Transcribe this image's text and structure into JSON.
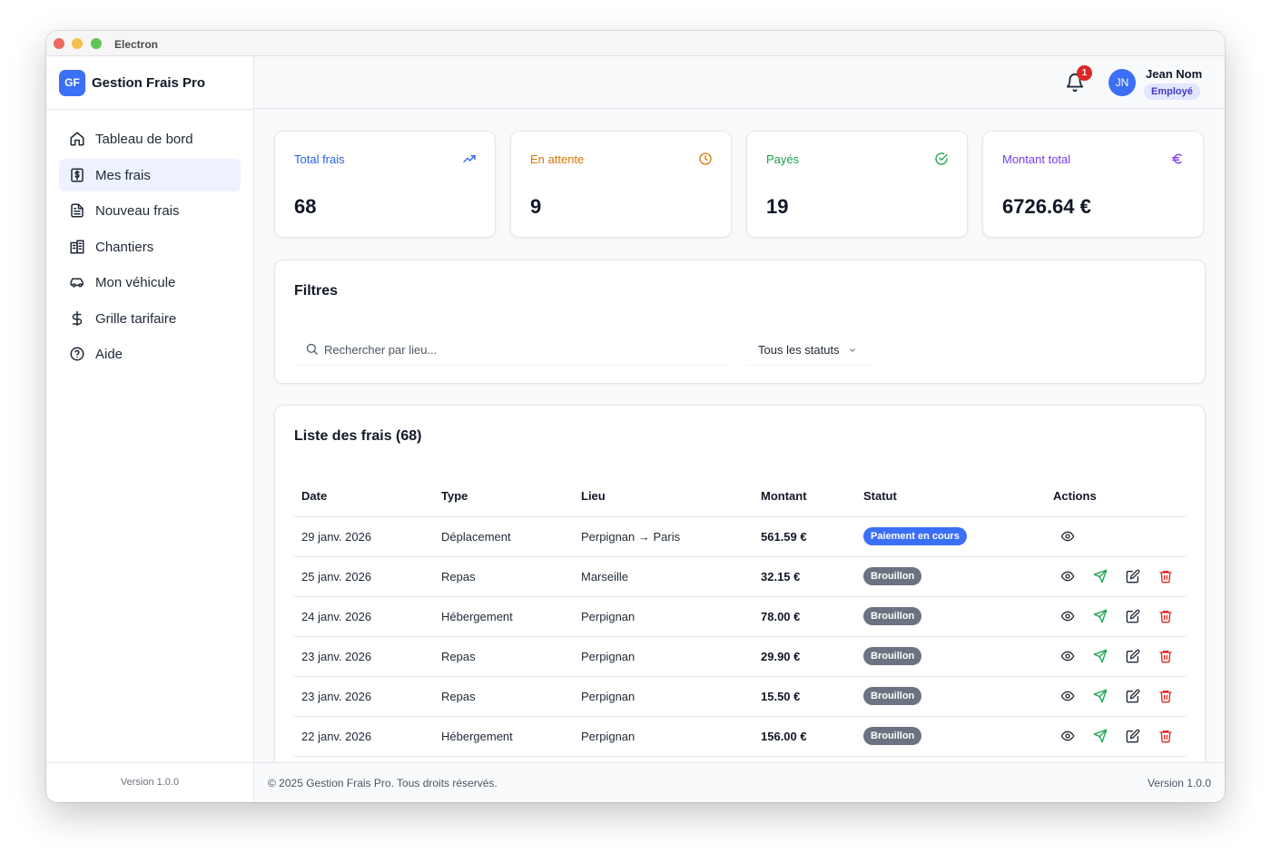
{
  "window": {
    "title": "Electron"
  },
  "brand": {
    "logo": "GF",
    "name": "Gestion Frais Pro"
  },
  "sidebar": {
    "items": [
      {
        "label": "Tableau de bord",
        "icon": "home-icon",
        "active": false
      },
      {
        "label": "Mes frais",
        "icon": "receipt-icon",
        "active": true
      },
      {
        "label": "Nouveau frais",
        "icon": "file-text-icon",
        "active": false
      },
      {
        "label": "Chantiers",
        "icon": "building-icon",
        "active": false
      },
      {
        "label": "Mon véhicule",
        "icon": "car-icon",
        "active": false
      },
      {
        "label": "Grille tarifaire",
        "icon": "dollar-icon",
        "active": false
      },
      {
        "label": "Aide",
        "icon": "help-circle-icon",
        "active": false
      }
    ],
    "version": "Version 1.0.0"
  },
  "header": {
    "notification_count": "1",
    "user": {
      "initials": "JN",
      "name": "Jean Nom",
      "role": "Employé"
    }
  },
  "stats": [
    {
      "label": "Total frais",
      "value": "68",
      "icon": "trending-up-icon",
      "color": "#2563eb"
    },
    {
      "label": "En attente",
      "value": "9",
      "icon": "clock-icon",
      "color": "#d97706"
    },
    {
      "label": "Payés",
      "value": "19",
      "icon": "check-circle-icon",
      "color": "#16a34a"
    },
    {
      "label": "Montant total",
      "value": "6726.64 €",
      "icon": "euro-icon",
      "color": "#7c3aed"
    }
  ],
  "filters": {
    "title": "Filtres",
    "search_placeholder": "Rechercher par lieu...",
    "status_value": "Tous les statuts"
  },
  "list": {
    "title": "Liste des frais (68)",
    "columns": [
      "Date",
      "Type",
      "Lieu",
      "Montant",
      "Statut",
      "Actions"
    ],
    "rows": [
      {
        "date": "29 janv. 2026",
        "type": "Déplacement",
        "lieu": "Perpignan → Paris",
        "montant": "561.59 €",
        "statut": "Paiement en cours",
        "status_color": "blue",
        "actions": [
          "view"
        ]
      },
      {
        "date": "25 janv. 2026",
        "type": "Repas",
        "lieu": "Marseille",
        "montant": "32.15 €",
        "statut": "Brouillon",
        "status_color": "gray",
        "actions": [
          "view",
          "send",
          "edit",
          "delete"
        ]
      },
      {
        "date": "24 janv. 2026",
        "type": "Hébergement",
        "lieu": "Perpignan",
        "montant": "78.00 €",
        "statut": "Brouillon",
        "status_color": "gray",
        "actions": [
          "view",
          "send",
          "edit",
          "delete"
        ]
      },
      {
        "date": "23 janv. 2026",
        "type": "Repas",
        "lieu": "Perpignan",
        "montant": "29.90 €",
        "statut": "Brouillon",
        "status_color": "gray",
        "actions": [
          "view",
          "send",
          "edit",
          "delete"
        ]
      },
      {
        "date": "23 janv. 2026",
        "type": "Repas",
        "lieu": "Perpignan",
        "montant": "15.50 €",
        "statut": "Brouillon",
        "status_color": "gray",
        "actions": [
          "view",
          "send",
          "edit",
          "delete"
        ]
      },
      {
        "date": "22 janv. 2026",
        "type": "Hébergement",
        "lieu": "Perpignan",
        "montant": "156.00 €",
        "statut": "Brouillon",
        "status_color": "gray",
        "actions": [
          "view",
          "send",
          "edit",
          "delete"
        ]
      }
    ]
  },
  "footer": {
    "copyright": "© 2025 Gestion Frais Pro. Tous droits réservés.",
    "version": "Version 1.0.0"
  }
}
